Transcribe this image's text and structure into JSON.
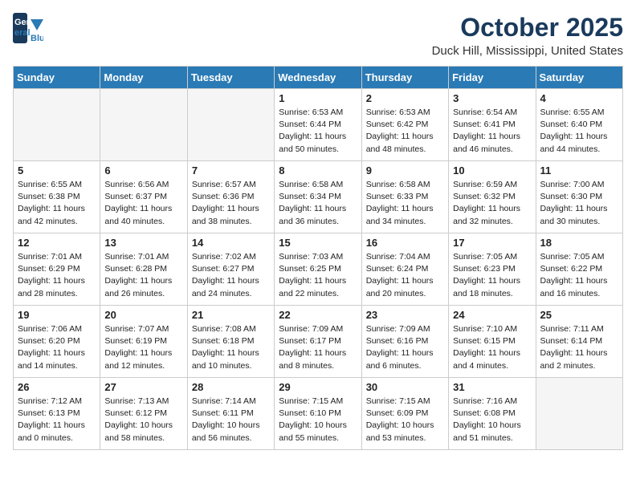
{
  "logo": {
    "line1": "General",
    "line2": "Blue"
  },
  "title": "October 2025",
  "location": "Duck Hill, Mississippi, United States",
  "weekdays": [
    "Sunday",
    "Monday",
    "Tuesday",
    "Wednesday",
    "Thursday",
    "Friday",
    "Saturday"
  ],
  "weeks": [
    [
      {
        "day": "",
        "empty": true
      },
      {
        "day": "",
        "empty": true
      },
      {
        "day": "",
        "empty": true
      },
      {
        "day": "1",
        "sunrise": "6:53 AM",
        "sunset": "6:44 PM",
        "daylight": "11 hours and 50 minutes."
      },
      {
        "day": "2",
        "sunrise": "6:53 AM",
        "sunset": "6:42 PM",
        "daylight": "11 hours and 48 minutes."
      },
      {
        "day": "3",
        "sunrise": "6:54 AM",
        "sunset": "6:41 PM",
        "daylight": "11 hours and 46 minutes."
      },
      {
        "day": "4",
        "sunrise": "6:55 AM",
        "sunset": "6:40 PM",
        "daylight": "11 hours and 44 minutes."
      }
    ],
    [
      {
        "day": "5",
        "sunrise": "6:55 AM",
        "sunset": "6:38 PM",
        "daylight": "11 hours and 42 minutes."
      },
      {
        "day": "6",
        "sunrise": "6:56 AM",
        "sunset": "6:37 PM",
        "daylight": "11 hours and 40 minutes."
      },
      {
        "day": "7",
        "sunrise": "6:57 AM",
        "sunset": "6:36 PM",
        "daylight": "11 hours and 38 minutes."
      },
      {
        "day": "8",
        "sunrise": "6:58 AM",
        "sunset": "6:34 PM",
        "daylight": "11 hours and 36 minutes."
      },
      {
        "day": "9",
        "sunrise": "6:58 AM",
        "sunset": "6:33 PM",
        "daylight": "11 hours and 34 minutes."
      },
      {
        "day": "10",
        "sunrise": "6:59 AM",
        "sunset": "6:32 PM",
        "daylight": "11 hours and 32 minutes."
      },
      {
        "day": "11",
        "sunrise": "7:00 AM",
        "sunset": "6:30 PM",
        "daylight": "11 hours and 30 minutes."
      }
    ],
    [
      {
        "day": "12",
        "sunrise": "7:01 AM",
        "sunset": "6:29 PM",
        "daylight": "11 hours and 28 minutes."
      },
      {
        "day": "13",
        "sunrise": "7:01 AM",
        "sunset": "6:28 PM",
        "daylight": "11 hours and 26 minutes."
      },
      {
        "day": "14",
        "sunrise": "7:02 AM",
        "sunset": "6:27 PM",
        "daylight": "11 hours and 24 minutes."
      },
      {
        "day": "15",
        "sunrise": "7:03 AM",
        "sunset": "6:25 PM",
        "daylight": "11 hours and 22 minutes."
      },
      {
        "day": "16",
        "sunrise": "7:04 AM",
        "sunset": "6:24 PM",
        "daylight": "11 hours and 20 minutes."
      },
      {
        "day": "17",
        "sunrise": "7:05 AM",
        "sunset": "6:23 PM",
        "daylight": "11 hours and 18 minutes."
      },
      {
        "day": "18",
        "sunrise": "7:05 AM",
        "sunset": "6:22 PM",
        "daylight": "11 hours and 16 minutes."
      }
    ],
    [
      {
        "day": "19",
        "sunrise": "7:06 AM",
        "sunset": "6:20 PM",
        "daylight": "11 hours and 14 minutes."
      },
      {
        "day": "20",
        "sunrise": "7:07 AM",
        "sunset": "6:19 PM",
        "daylight": "11 hours and 12 minutes."
      },
      {
        "day": "21",
        "sunrise": "7:08 AM",
        "sunset": "6:18 PM",
        "daylight": "11 hours and 10 minutes."
      },
      {
        "day": "22",
        "sunrise": "7:09 AM",
        "sunset": "6:17 PM",
        "daylight": "11 hours and 8 minutes."
      },
      {
        "day": "23",
        "sunrise": "7:09 AM",
        "sunset": "6:16 PM",
        "daylight": "11 hours and 6 minutes."
      },
      {
        "day": "24",
        "sunrise": "7:10 AM",
        "sunset": "6:15 PM",
        "daylight": "11 hours and 4 minutes."
      },
      {
        "day": "25",
        "sunrise": "7:11 AM",
        "sunset": "6:14 PM",
        "daylight": "11 hours and 2 minutes."
      }
    ],
    [
      {
        "day": "26",
        "sunrise": "7:12 AM",
        "sunset": "6:13 PM",
        "daylight": "11 hours and 0 minutes."
      },
      {
        "day": "27",
        "sunrise": "7:13 AM",
        "sunset": "6:12 PM",
        "daylight": "10 hours and 58 minutes."
      },
      {
        "day": "28",
        "sunrise": "7:14 AM",
        "sunset": "6:11 PM",
        "daylight": "10 hours and 56 minutes."
      },
      {
        "day": "29",
        "sunrise": "7:15 AM",
        "sunset": "6:10 PM",
        "daylight": "10 hours and 55 minutes."
      },
      {
        "day": "30",
        "sunrise": "7:15 AM",
        "sunset": "6:09 PM",
        "daylight": "10 hours and 53 minutes."
      },
      {
        "day": "31",
        "sunrise": "7:16 AM",
        "sunset": "6:08 PM",
        "daylight": "10 hours and 51 minutes."
      },
      {
        "day": "",
        "empty": true
      }
    ]
  ]
}
